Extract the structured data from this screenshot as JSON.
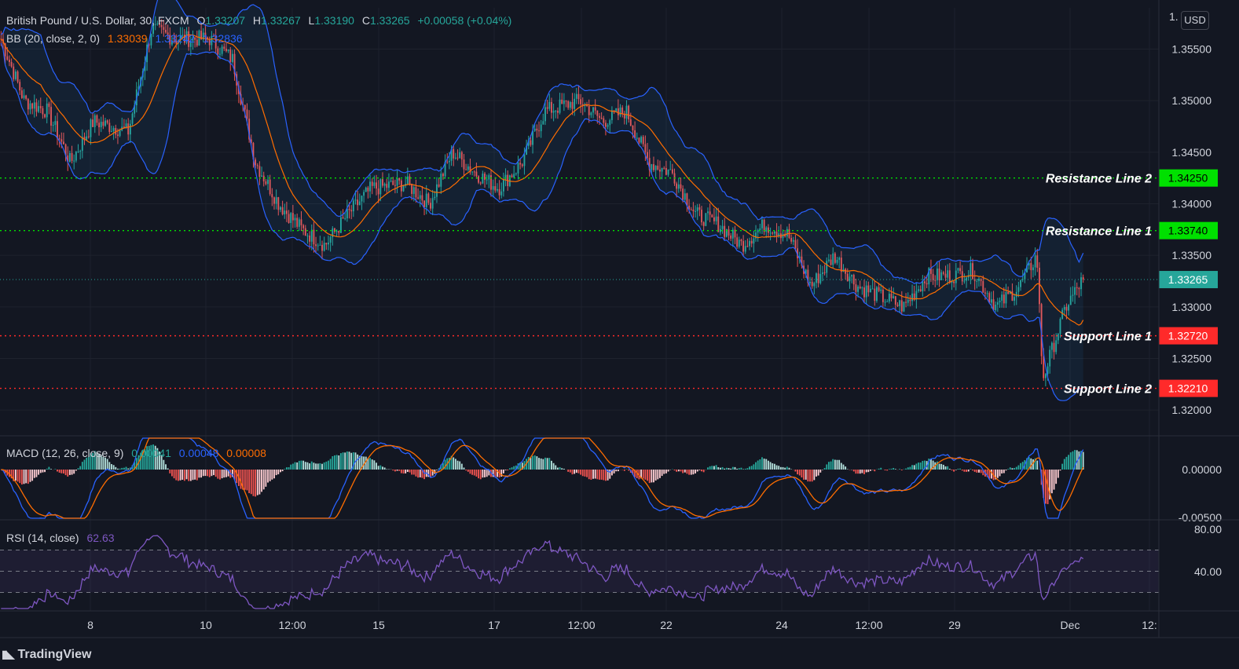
{
  "header": {
    "symbol": "British Pound / U.S. Dollar, 30, FXCM",
    "ohlc": {
      "o_label": "O",
      "o": "1.33207",
      "h_label": "H",
      "h": "1.33267",
      "l_label": "L",
      "l": "1.33190",
      "c_label": "C",
      "c": "1.33265",
      "change": "+0.00058 (+0.04%)"
    },
    "bb_label": "BB (20, close, 2, 0)",
    "bb_values": [
      "1.33039",
      "1.33242",
      "1.32836"
    ]
  },
  "currency_button": "USD",
  "macd": {
    "label": "MACD (12, 26, close, 9)",
    "values": [
      "0.00041",
      "0.00048",
      "0.00008"
    ]
  },
  "rsi": {
    "label": "RSI (14, close)",
    "value": "62.63"
  },
  "logo_text": "TradingView",
  "colors": {
    "background": "#131722",
    "up": "#26a69a",
    "down": "#ef5350",
    "bb_band": "#2962ff",
    "bb_basis": "#ff6d00",
    "rsi": "#7e57c2",
    "resistance": "#00e000",
    "support": "#ff2a2a",
    "last_price": "#26a69a"
  },
  "chart_data": [
    {
      "type": "candlestick",
      "symbol": "GBPUSD",
      "timeframe": "30",
      "price_axis": {
        "ticks": [
          1.355,
          1.35,
          1.345,
          1.34,
          1.335,
          1.33,
          1.325,
          1.32
        ],
        "range": [
          1.3175,
          1.359
        ]
      },
      "time_axis": {
        "labels": [
          "8",
          "10",
          "12:00",
          "15",
          "17",
          "12:00",
          "22",
          "24",
          "12:00",
          "29",
          "Dec",
          "12:"
        ]
      },
      "horizontal_lines": [
        {
          "name": "Resistance Line 2",
          "price": 1.3425,
          "price_label": "1.34250",
          "color": "#00e000"
        },
        {
          "name": "Resistance Line 1",
          "price": 1.3374,
          "price_label": "1.33740",
          "color": "#00e000"
        },
        {
          "name": "Support Line 1",
          "price": 1.3272,
          "price_label": "1.32720",
          "color": "#ff2a2a"
        },
        {
          "name": "Support Line 2",
          "price": 1.3221,
          "price_label": "1.32210",
          "color": "#ff2a2a"
        }
      ],
      "last_price": {
        "price": 1.33265,
        "label": "1.33265"
      },
      "approx_close_path": [
        [
          0,
          1.356
        ],
        [
          0.02,
          1.35
        ],
        [
          0.04,
          1.349
        ],
        [
          0.06,
          1.344
        ],
        [
          0.08,
          1.348
        ],
        [
          0.11,
          1.347
        ],
        [
          0.13,
          1.357
        ],
        [
          0.15,
          1.356
        ],
        [
          0.18,
          1.356
        ],
        [
          0.2,
          1.354
        ],
        [
          0.22,
          1.344
        ],
        [
          0.24,
          1.34
        ],
        [
          0.26,
          1.3375
        ],
        [
          0.28,
          1.336
        ],
        [
          0.3,
          1.339
        ],
        [
          0.32,
          1.3415
        ],
        [
          0.35,
          1.342
        ],
        [
          0.37,
          1.34
        ],
        [
          0.39,
          1.345
        ],
        [
          0.41,
          1.343
        ],
        [
          0.43,
          1.3415
        ],
        [
          0.45,
          1.344
        ],
        [
          0.47,
          1.349
        ],
        [
          0.5,
          1.35
        ],
        [
          0.52,
          1.348
        ],
        [
          0.54,
          1.349
        ],
        [
          0.56,
          1.344
        ],
        [
          0.58,
          1.343
        ],
        [
          0.6,
          1.339
        ],
        [
          0.62,
          1.338
        ],
        [
          0.64,
          1.336
        ],
        [
          0.66,
          1.338
        ],
        [
          0.68,
          1.337
        ],
        [
          0.7,
          1.332
        ],
        [
          0.72,
          1.335
        ],
        [
          0.74,
          1.332
        ],
        [
          0.76,
          1.331
        ],
        [
          0.78,
          1.33
        ],
        [
          0.8,
          1.333
        ],
        [
          0.82,
          1.333
        ],
        [
          0.84,
          1.3335
        ],
        [
          0.86,
          1.33
        ],
        [
          0.88,
          1.332
        ],
        [
          0.895,
          1.335
        ],
        [
          0.9,
          1.323
        ],
        [
          0.92,
          1.33
        ],
        [
          0.935,
          1.3327
        ]
      ]
    },
    {
      "type": "line",
      "name": "MACD (12, 26, close, 9)",
      "axis": {
        "ticks": [
          0.0,
          -0.005
        ],
        "tick_labels": [
          "0.00000",
          "-0.00500"
        ]
      },
      "values": [
        "0.00041",
        "0.00048",
        "0.00008"
      ]
    },
    {
      "type": "line",
      "name": "RSI (14, close)",
      "axis": {
        "ticks": [
          80,
          40
        ],
        "tick_labels": [
          "80.00",
          "40.00"
        ],
        "band": [
          30,
          70
        ]
      },
      "last_value": 62.63
    }
  ]
}
